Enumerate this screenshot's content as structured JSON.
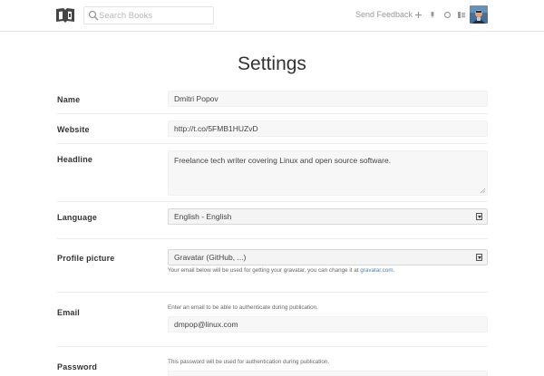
{
  "header": {
    "search_placeholder": "Search Books",
    "feedback_label": "Send Feedback",
    "icons": [
      "book-logo-icon",
      "search-icon",
      "plus-icon",
      "bell-icon",
      "circle-icon",
      "user-menu-icon"
    ]
  },
  "page": {
    "title": "Settings"
  },
  "form": {
    "name": {
      "label": "Name",
      "value": "Dmitri Popov"
    },
    "website": {
      "label": "Website",
      "value": "http://t.co/5FMB1HUZvD"
    },
    "headline": {
      "label": "Headline",
      "value": "Freelance tech writer covering Linux and open source software."
    },
    "language": {
      "label": "Language",
      "selected": "English - English"
    },
    "profile_picture": {
      "label": "Profile picture",
      "selected": "Gravatar (GitHub, ...)",
      "help_prefix": "Your email below will be used for getting your gravatar, you can change it at ",
      "help_link": "gravatar.com",
      "help_suffix": "."
    },
    "email": {
      "label": "Email",
      "help": "Enter an email to be able to authenticate during publication.",
      "value": "dmpop@linux.com"
    },
    "password": {
      "label": "Password",
      "help": "This password will be used for authentication during publication."
    }
  },
  "colors": {
    "link": "#4183c4",
    "divider": "#ededed",
    "field_bg": "#f7f7f7"
  }
}
